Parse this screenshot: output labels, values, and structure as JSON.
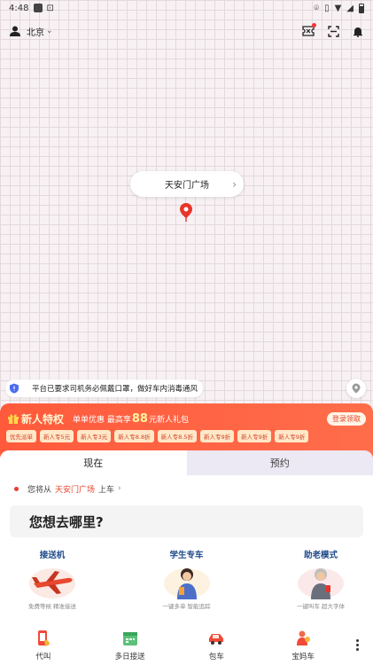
{
  "status": {
    "time": "4:48"
  },
  "topbar": {
    "city": "北京"
  },
  "map": {
    "pickup_pill": "天安门广场"
  },
  "notice": {
    "text": "平台已要求司机务必佩戴口罩，做好车内消毒通风"
  },
  "promo": {
    "title": "新人特权",
    "subtitle_pre": "单单优惠 最高享",
    "amount": "88",
    "subtitle_post": "元新人礼包",
    "button": "登录领取",
    "coupons": [
      "优先派单",
      "新人专5元",
      "新人专3元",
      "新人专8.8折",
      "新人专8.5折",
      "新人专9折",
      "新人专9折",
      "新人专9折"
    ]
  },
  "booking": {
    "tabs": [
      "现在",
      "预约"
    ],
    "from_prefix": "您将从",
    "from_place": "天安门广场",
    "from_suffix": "上车",
    "destination_placeholder": "您想去哪里?"
  },
  "services": [
    {
      "title": "接送机",
      "desc": "免费等候 精准接送"
    },
    {
      "title": "学生专车",
      "desc": "一键多单 智能追踪"
    },
    {
      "title": "助老模式",
      "desc": "一键叫车 超大字体"
    }
  ],
  "bottomnav": [
    {
      "label": "代叫"
    },
    {
      "label": "多日接送"
    },
    {
      "label": "包车"
    },
    {
      "label": "宝妈车"
    }
  ],
  "colors": {
    "brand_red": "#ff5a3c",
    "pin_red": "#e8352a",
    "service_blue": "#1f4a8a"
  }
}
